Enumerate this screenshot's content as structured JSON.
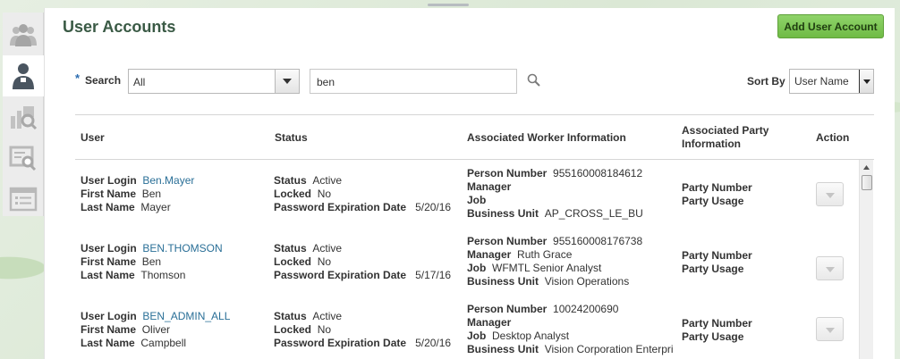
{
  "page": {
    "title": "User Accounts",
    "add_button": "Add User Account"
  },
  "search": {
    "required_marker": "*",
    "label": "Search",
    "scope_value": "All",
    "query_value": "ben"
  },
  "sort": {
    "label": "Sort By",
    "value": "User Name"
  },
  "columns": {
    "user": "User",
    "status": "Status",
    "worker": "Associated Worker Information",
    "party_line1": "Associated Party",
    "party_line2": "Information",
    "action": "Action"
  },
  "labels": {
    "user_login": "User Login",
    "first_name": "First Name",
    "last_name": "Last Name",
    "status": "Status",
    "locked": "Locked",
    "password_expiration": "Password Expiration Date",
    "person_number": "Person Number",
    "manager": "Manager",
    "job": "Job",
    "business_unit": "Business Unit",
    "party_number": "Party Number",
    "party_usage": "Party Usage"
  },
  "rows": [
    {
      "user_login": "Ben.Mayer",
      "first_name": "Ben",
      "last_name": "Mayer",
      "status": "Active",
      "locked": "No",
      "password_expiration": "5/20/16",
      "person_number": "955160008184612",
      "manager": "",
      "job": "",
      "business_unit": "AP_CROSS_LE_BU"
    },
    {
      "user_login": "BEN.THOMSON",
      "first_name": "Ben",
      "last_name": "Thomson",
      "status": "Active",
      "locked": "No",
      "password_expiration": "5/17/16",
      "person_number": "955160008176738",
      "manager": "Ruth Grace",
      "job": "WFMTL Senior Analyst",
      "business_unit": "Vision Operations"
    },
    {
      "user_login": "BEN_ADMIN_ALL",
      "first_name": "Oliver",
      "last_name": "Campbell",
      "status": "Active",
      "locked": "No",
      "password_expiration": "5/20/16",
      "person_number": "10024200690",
      "manager": "",
      "job": "Desktop Analyst",
      "business_unit": "Vision Corporation Enterpri"
    }
  ],
  "icons": {
    "rail": [
      "users-group-icon",
      "user-account-icon",
      "search-report-icon",
      "certificate-search-icon",
      "list-report-icon"
    ],
    "search": "search-icon",
    "dropdown": "chevron-down-icon"
  },
  "colors": {
    "accent_green": "#6fbb45",
    "link": "#2a6f97",
    "title": "#3a5a45"
  }
}
